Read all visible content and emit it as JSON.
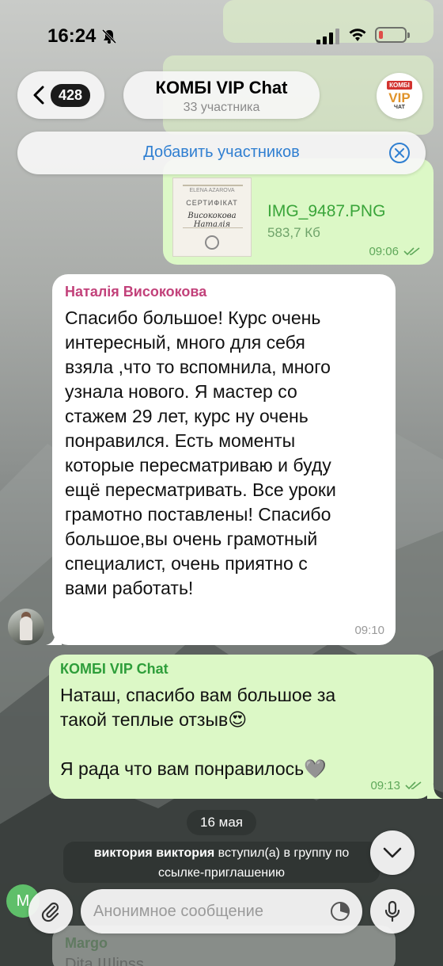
{
  "status_bar": {
    "time": "16:24",
    "battery_level": 0.15,
    "battery_color": "#e22a2a"
  },
  "header": {
    "back_count": "428",
    "chat_title": "КОМБІ VIP Chat",
    "members": "33 участника",
    "logo": {
      "top": "КОМБІ",
      "middle": "VIP",
      "bottom": "ЧАТ"
    },
    "add_members": "Добавить участников"
  },
  "messages": {
    "file": {
      "file_name": "IMG_9487.PNG",
      "file_size": "583,7 Кб",
      "time": "09:06",
      "thumbnail": {
        "brand": "ELENA AZAROVA",
        "title": "СЕРТИФІКАТ",
        "name": "Висококова Наталія"
      }
    },
    "incoming": {
      "sender": "Наталія Висококова",
      "text": "Спасибо большое! Курс очень\nинтересный, много для себя\nвзяла ,что то вспомнила, много\nузнала нового. Я мастер со\nстажем 29 лет, курс ну очень\nпонравился. Есть моменты\nкоторые пересматриваю и буду\nещё пересматривать. Все уроки\nграмотно поставлены! Спасибо\nбольшое,вы очень грамотный\nспециалист, очень приятно с\nвами работать!",
      "time": "09:10"
    },
    "reply": {
      "sender": "КОМБІ VIP Chat",
      "text": "Наташ, спасибо вам большое за\nтакой теплые отзыв😍\n\nЯ рада что вам понравилось🩶",
      "time": "09:13"
    },
    "date_separator": "16 мая",
    "service": {
      "user": "виктория виктория",
      "action": "вступил(а) в группу по",
      "action2": "ссылке-приглашению"
    },
    "partial": {
      "avatar_letter": "M",
      "sender": "Margo",
      "text": "Dita Щlinss"
    }
  },
  "input": {
    "placeholder": "Анонимное сообщение"
  },
  "colors": {
    "outgoing_bubble": "#dcf8c6",
    "incoming_bubble": "#ffffff",
    "sender_incoming": "#c2417a",
    "sender_outgoing": "#2e9e3a",
    "accent_link": "#2f7fd1"
  }
}
